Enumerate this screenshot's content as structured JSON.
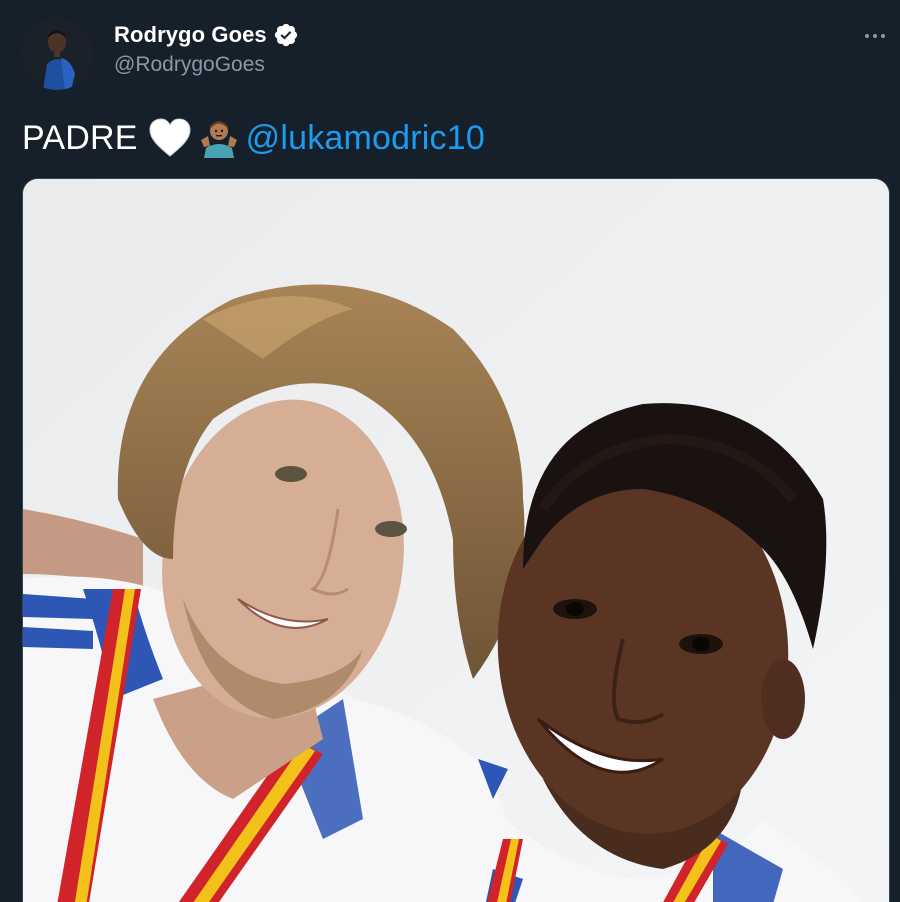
{
  "tweet": {
    "author": {
      "display_name": "Rodrygo Goes",
      "handle": "@RodrygoGoes",
      "verified": true,
      "avatar_icon": "avatar-photo"
    },
    "text": {
      "lead": "PADRE",
      "emoji": [
        "white-heart",
        "person-shrugging"
      ],
      "mention": "@lukamodric10"
    },
    "more_icon": "more-horizontal-icon",
    "media": {
      "type": "photo",
      "icon": "selfie-photo"
    }
  },
  "colors": {
    "background": "#15202b",
    "primary_text": "#ffffff",
    "secondary_text": "#8b98a5",
    "accent": "#1d9bf0",
    "border": "#38444d"
  }
}
